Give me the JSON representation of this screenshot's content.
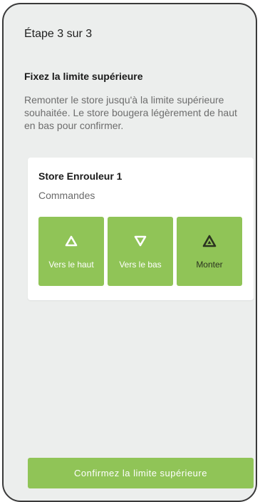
{
  "header": {
    "step": "Étape 3 sur 3"
  },
  "section": {
    "title": "Fixez la limite supérieure",
    "description": "Remonter le store jusqu'à la limite supérieure souhaitée. Le store bougera légèrement de haut en bas pour confirmer."
  },
  "device": {
    "name": "Store Enrouleur 1",
    "controls_label": "Commandes",
    "buttons": [
      {
        "label": "Vers le haut",
        "icon": "triangle-up-icon"
      },
      {
        "label": "Vers le bas",
        "icon": "triangle-down-icon"
      },
      {
        "label": "Monter",
        "icon": "raise-icon"
      }
    ]
  },
  "footer": {
    "confirm_label": "Confirmez la limite supérieure"
  },
  "colors": {
    "accent": "#90c457",
    "background": "#eceeed",
    "card": "#ffffff"
  }
}
